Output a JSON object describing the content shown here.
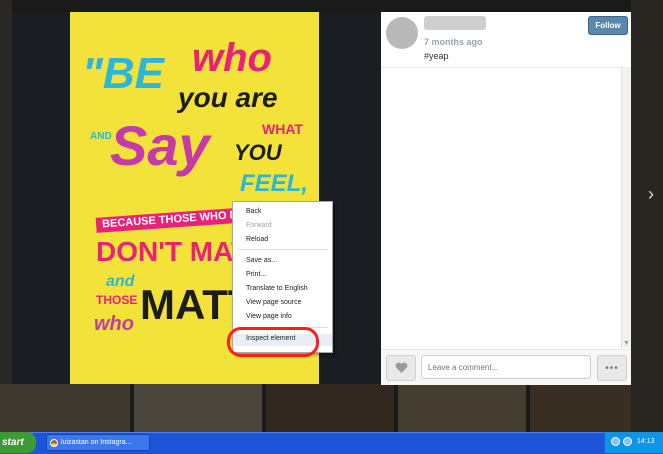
{
  "poster": {
    "lines": [
      "\"BE",
      "who",
      "you are",
      "AND",
      "Say",
      "WHAT",
      "YOU",
      "FEEL,",
      "BECAUSE THOSE WHO MIND",
      "DON'T MATTER",
      "and",
      "THOSE",
      "who",
      "MATTER"
    ]
  },
  "post": {
    "time": "7 months ago",
    "caption": "#yeap",
    "follow_label": "Follow",
    "comment_placeholder": "Leave a comment...",
    "more_label": "•••"
  },
  "context_menu": {
    "items": [
      {
        "label": "Back",
        "enabled": true
      },
      {
        "label": "Forward",
        "enabled": false
      },
      {
        "label": "Reload",
        "enabled": true
      },
      {
        "label": "Save as...",
        "enabled": true
      },
      {
        "label": "Print...",
        "enabled": true
      },
      {
        "label": "Translate to English",
        "enabled": true
      },
      {
        "label": "View page source",
        "enabled": true
      },
      {
        "label": "View page info",
        "enabled": true
      },
      {
        "label": "Inspect element",
        "enabled": true,
        "highlighted": true
      }
    ]
  },
  "taskbar": {
    "start_label": "start",
    "task_label": "luizastan on Instagra...",
    "clock": "14:13"
  },
  "colors": {
    "poster_bg": "#f2e23a",
    "follow_button": "#5b86ad",
    "highlight_circle": "#ff1c1c",
    "taskbar": "#1f54d9",
    "start_button": "#3d9b35"
  }
}
